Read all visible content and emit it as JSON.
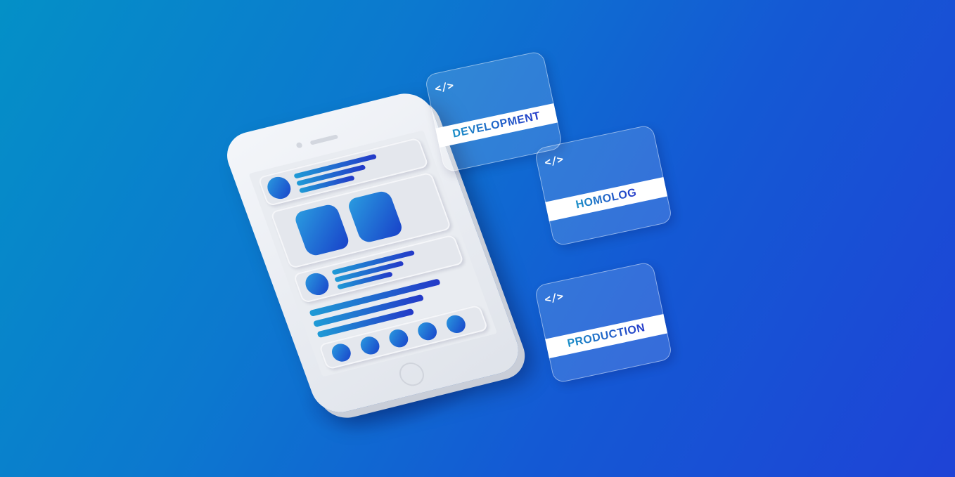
{
  "phone": {
    "screen_blocks": [
      "header-card",
      "image-card",
      "profile-card",
      "text-lines",
      "dots-card"
    ]
  },
  "environments": [
    {
      "label": "DEVELOPMENT",
      "icon": "code-icon",
      "icon_glyph": "</>"
    },
    {
      "label": "HOMOLOG",
      "icon": "code-icon",
      "icon_glyph": "</>"
    },
    {
      "label": "PRODUCTION",
      "icon": "code-icon",
      "icon_glyph": "</>"
    }
  ],
  "colors": {
    "background_start": "#0490c7",
    "background_end": "#1e43d6",
    "accent_cyan": "#1a8fc7",
    "accent_blue": "#2439c9",
    "phone_body": "#f4f6fa"
  }
}
